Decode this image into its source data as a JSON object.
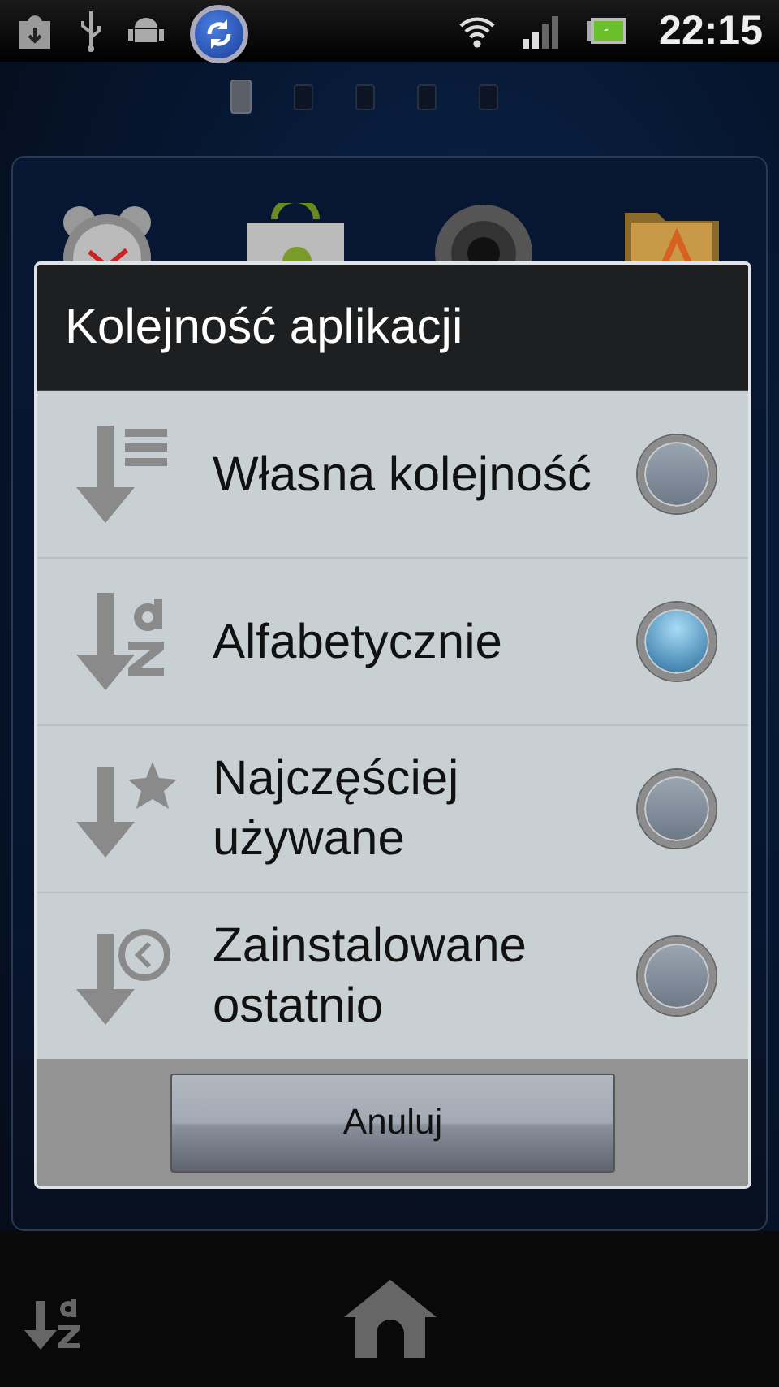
{
  "status_bar": {
    "time": "22:15"
  },
  "home_pages": [
    {
      "selected": true
    },
    {
      "selected": false
    },
    {
      "selected": false
    },
    {
      "selected": false
    },
    {
      "selected": false
    }
  ],
  "dialog": {
    "title": "Kolejność aplikacji",
    "options": [
      {
        "kind": "custom",
        "label": "Własna kolejność",
        "selected": false
      },
      {
        "kind": "alphabetical",
        "label": "Alfabetycznie",
        "selected": true
      },
      {
        "kind": "most-used",
        "label": "Najczęściej używane",
        "selected": false
      },
      {
        "kind": "recent",
        "label": "Zainstalowane ostatnio",
        "selected": false
      }
    ],
    "cancel_button": "Anuluj"
  }
}
